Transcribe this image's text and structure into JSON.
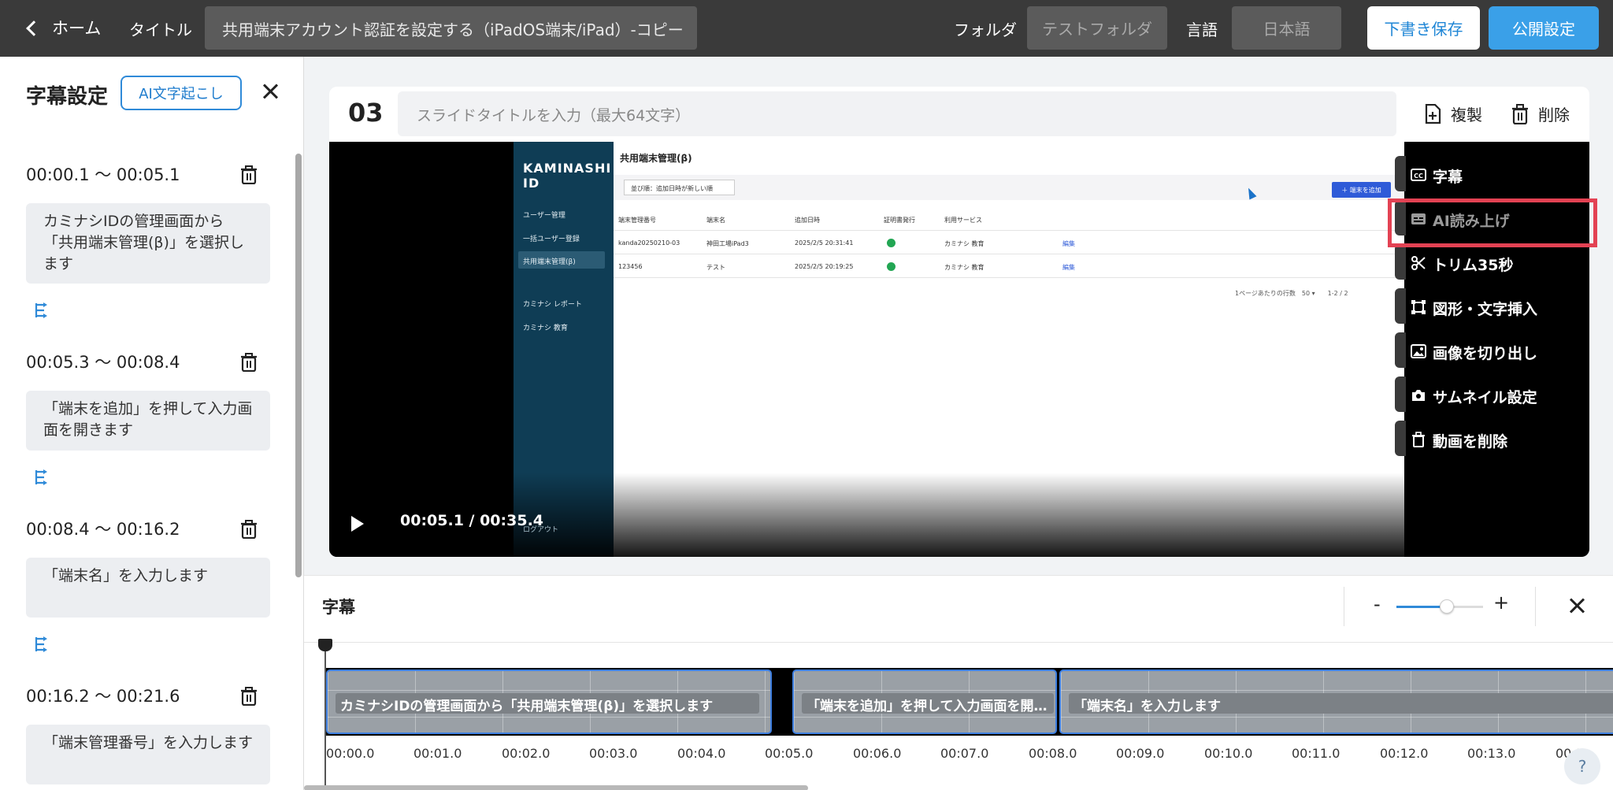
{
  "topbar": {
    "home_label": "ホーム",
    "title_label": "タイトル",
    "title_value": "共用端末アカウント認証を設定する（iPadOS端末/iPad）-コピー",
    "folder_label": "フォルダ",
    "folder_value": "テストフォルダ",
    "language_label": "言語",
    "language_value": "日本語",
    "draft_save": "下書き保存",
    "publish": "公開設定"
  },
  "subtitle_panel": {
    "title": "字幕設定",
    "ai_button": "AI文字起こし",
    "segments": [
      {
        "time": "00:00.1 〜 00:05.1",
        "text": "カミナシIDの管理画面から「共用端末管理(β)」を選択します"
      },
      {
        "time": "00:05.3 〜 00:08.4",
        "text": "「端末を追加」を押して入力画面を開きます"
      },
      {
        "time": "00:08.4 〜 00:16.2",
        "text": "「端末名」を入力します"
      },
      {
        "time": "00:16.2 〜 00:21.6",
        "text": "「端末管理番号」を入力します"
      }
    ]
  },
  "slide": {
    "number": "03",
    "title_placeholder": "スライドタイトルを入力（最大64文字）",
    "duplicate": "複製",
    "delete": "削除"
  },
  "video": {
    "time": "00:05.1 / 00:35.4",
    "screen": {
      "logo": "KAMINASHI ID",
      "nav": [
        "ユーザー管理",
        "一括ユーザー登録",
        "共用端末管理(β)",
        "カミナシ レポート",
        "カミナシ 教育"
      ],
      "logout": "ログアウト",
      "page_title": "共用端末管理(β)",
      "sort_label": "並び順：追加日時が新しい順",
      "add_button": "＋ 端末を追加",
      "columns": [
        "端末管理番号",
        "端末名",
        "追加日時",
        "証明書発行",
        "利用サービス"
      ],
      "rows": [
        {
          "id": "kanda20250210-03",
          "name": "神田工場iPad3",
          "date": "2025/2/5 20:31:41",
          "service": "カミナシ 教育",
          "action": "編集"
        },
        {
          "id": "123456",
          "name": "テスト",
          "date": "2025/2/5 20:19:25",
          "service": "カミナシ 教育",
          "action": "編集"
        }
      ],
      "pager": "1ページあたりの行数　50 ▾　　1-2 / 2"
    }
  },
  "tools": [
    {
      "label": "字幕",
      "icon": "cc-icon",
      "enabled": true
    },
    {
      "label": "AI読み上げ",
      "icon": "subtitles-icon",
      "enabled": false
    },
    {
      "label": "トリム35秒",
      "icon": "scissors-icon",
      "enabled": true
    },
    {
      "label": "図形・文字挿入",
      "icon": "shape-icon",
      "enabled": true
    },
    {
      "label": "画像を切り出し",
      "icon": "image-icon",
      "enabled": true
    },
    {
      "label": "サムネイル設定",
      "icon": "camera-icon",
      "enabled": true
    },
    {
      "label": "動画を削除",
      "icon": "trash-icon",
      "enabled": true
    }
  ],
  "timeline": {
    "title": "字幕",
    "zoom_minus": "-",
    "zoom_plus": "+",
    "zoom_level": 0.58,
    "clips": [
      "カミナシIDの管理画面から「共用端末管理(β)」を選択します",
      "「端末を追加」を押して入力画面を開き…",
      "「端末名」を入力します"
    ],
    "ticks": [
      "00:00.0",
      "00:01.0",
      "00:02.0",
      "00:03.0",
      "00:04.0",
      "00:05.0",
      "00:06.0",
      "00:07.0",
      "00:08.0",
      "00:09.0",
      "00:10.0",
      "00:11.0",
      "00:12.0",
      "00:13.0",
      "00:1"
    ]
  },
  "help": "?"
}
